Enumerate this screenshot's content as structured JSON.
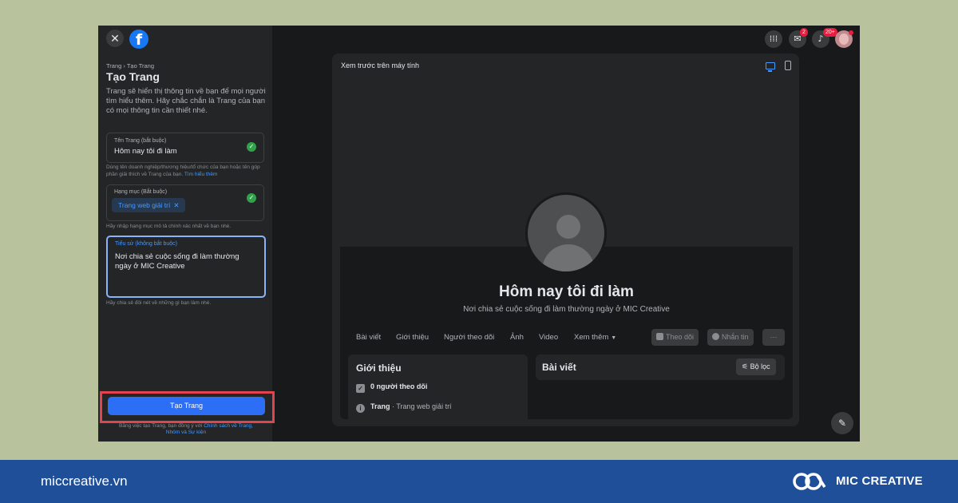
{
  "topbar": {
    "close_icon": "close-icon",
    "logo": "f",
    "messenger_badge": "2",
    "notifications_badge": "20+"
  },
  "sidebar": {
    "breadcrumb": "Trang › Tạo Trang",
    "title": "Tạo Trang",
    "description": "Trang sẽ hiển thị thông tin về bạn để mọi người tìm hiểu thêm. Hãy chắc chắn là Trang của bạn có mọi thông tin cần thiết nhé.",
    "name_field": {
      "label": "Tên Trang (bắt buộc)",
      "value": "Hôm nay tôi đi làm"
    },
    "name_hint": "Dùng tên doanh nghiệp/thương hiệu/tổ chức của bạn hoặc tên góp phần giải thích về Trang của bạn.",
    "name_hint_link": "Tìm hiểu thêm",
    "category_field": {
      "label": "Hạng mục (Bắt buộc)",
      "chip": "Trang web giải trí",
      "chip_remove": "✕"
    },
    "category_hint": "Hãy nhập hạng mục mô tả chính xác nhất về bạn nhé.",
    "bio_field": {
      "label": "Tiểu sử (không bắt buộc)",
      "value": "Nơi chia sẻ cuộc sống đi làm thường ngày ở MIC Creative"
    },
    "bio_hint": "Hãy chia sẻ đôi nét về những gì bạn làm nhé.",
    "create_button": "Tạo Trang",
    "terms_text": "Bằng việc tạo Trang, bạn đồng ý với",
    "terms_link_1": "Chính sách về Trang,",
    "terms_link_2": "Nhóm và Sự kiện"
  },
  "preview": {
    "title": "Xem trước trên máy tính",
    "page_name": "Hôm nay tôi đi làm",
    "page_bio": "Nơi chia sẻ cuộc sống đi làm thường ngày ở MIC Creative",
    "tabs": [
      "Bài viết",
      "Giới thiệu",
      "Người theo dõi",
      "Ảnh",
      "Video",
      "Xem thêm"
    ],
    "follow_button": "Theo dõi",
    "message_button": "Nhắn tin",
    "more_button": "···",
    "intro_title": "Giới thiệu",
    "followers": "0 người theo dõi",
    "page_type_label": "Trang",
    "page_type_value": "· Trang web giải trí",
    "posts_title": "Bài viết",
    "filter_button": "Bộ lọc"
  },
  "footer": {
    "site": "miccreative.vn",
    "brand": "MIC CREATIVE"
  },
  "colors": {
    "background": "#b8c39d",
    "footer": "#1f4f98",
    "accent": "#2d6ef6",
    "highlight_border": "#e2444f"
  }
}
